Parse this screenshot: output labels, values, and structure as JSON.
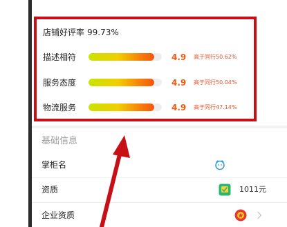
{
  "store_rating": {
    "title": "店铺好评率",
    "percent": "99.73%",
    "items": [
      {
        "label": "描述相符",
        "score": "4.9",
        "compare": "高于同行50.62%",
        "fill": 0.9
      },
      {
        "label": "服务态度",
        "score": "4.9",
        "compare": "高于同行50.04%",
        "fill": 0.9
      },
      {
        "label": "物流服务",
        "score": "4.9",
        "compare": "高于同行47.14%",
        "fill": 0.9
      }
    ]
  },
  "basic_info": {
    "section_title": "基础信息",
    "rows": [
      {
        "label": "掌柜名",
        "icon": "wangwang-chat-icon"
      },
      {
        "label": "资质",
        "icon": "qualification-badge-icon",
        "value": "1011元"
      },
      {
        "label": "企业资质",
        "icon": "business-license-emblem-icon",
        "action_icon": "chevron-right-icon"
      }
    ]
  },
  "annotation": {
    "highlight_color": "#c80f15",
    "arrow_color": "#c80f15"
  },
  "colors": {
    "score": "#f05b10",
    "compare": "#e4532a",
    "section_title": "#9a9a9a"
  }
}
